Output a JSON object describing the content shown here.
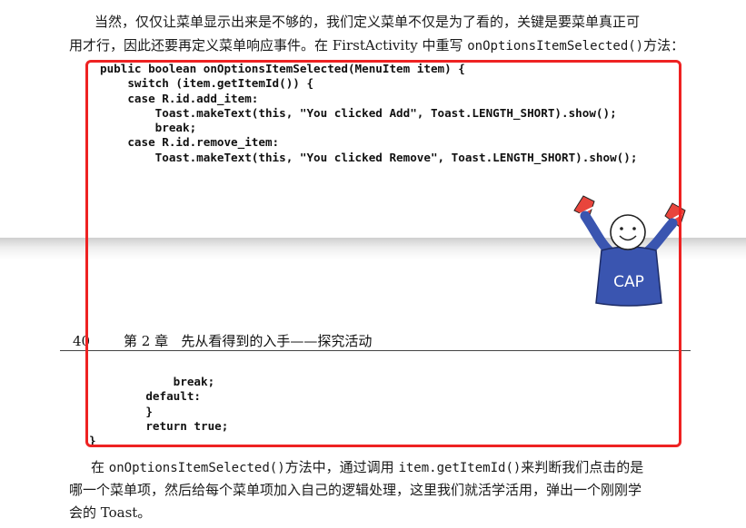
{
  "top_paragraph": {
    "line1": "当然，仅仅让菜单显示出来是不够的，我们定义菜单不仅是为了看的，关键是要菜单真正可",
    "line2_pre": "用才行，因此还要再定义菜单响应事件。在 FirstActivity 中重写 ",
    "line2_code": "onOptionsItemSelected()",
    "line2_post": "方法："
  },
  "code_part1": [
    "public boolean onOptionsItemSelected(MenuItem item) {",
    "    switch (item.getItemId()) {",
    "    case R.id.add_item:",
    "        Toast.makeText(this, \"You clicked Add\", Toast.LENGTH_SHORT).show();",
    "        break;",
    "    case R.id.remove_item:",
    "        Toast.makeText(this, \"You clicked Remove\", Toast.LENGTH_SHORT).show();"
  ],
  "page_header": {
    "page_number": "40",
    "chapter_title": "第 2 章   先从看得到的入手——探究活动"
  },
  "code_part2": [
    "        break;",
    "    default:",
    "    }",
    "    return true;",
    "}"
  ],
  "bottom_paragraph": {
    "l1_pre": "在 ",
    "l1_code1": "onOptionsItemSelected()",
    "l1_mid": "方法中，通过调用 ",
    "l1_code2": "item.getItemId()",
    "l1_post": "来判断我们点击的是",
    "line2": "哪一个菜单项，然后给每个菜单项加入自己的逻辑处理，这里我们就活学活用，弹出一个刚刚学",
    "line3": "会的 Toast。"
  },
  "mascot": {
    "shirt_text": "CAP"
  },
  "colors": {
    "highlight": "#ee2222",
    "mascot_shirt": "#3a55b0"
  }
}
